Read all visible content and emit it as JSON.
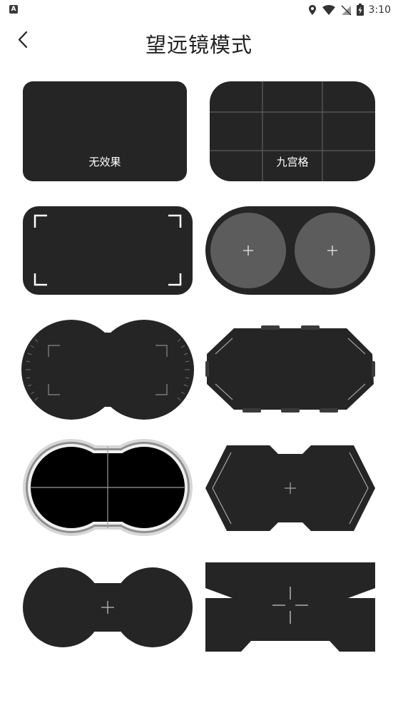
{
  "status_bar": {
    "time": "3:10",
    "left_icon": "A",
    "icons": [
      "location-icon",
      "wifi-icon",
      "no-sim-icon",
      "battery-charging-icon"
    ]
  },
  "header": {
    "title": "望远镜模式",
    "back_icon": "chevron-left-icon"
  },
  "modes": [
    {
      "id": "no-effect",
      "label": "无效果"
    },
    {
      "id": "nine-grid",
      "label": "九宫格"
    },
    {
      "id": "corner-brackets",
      "label": ""
    },
    {
      "id": "twin-circles",
      "label": ""
    },
    {
      "id": "binocular-scale",
      "label": ""
    },
    {
      "id": "octagon",
      "label": ""
    },
    {
      "id": "binocular-metal",
      "label": ""
    },
    {
      "id": "hexagon-notch",
      "label": ""
    },
    {
      "id": "dumbbell",
      "label": ""
    },
    {
      "id": "bowtie-crosshair",
      "label": ""
    }
  ],
  "colors": {
    "tile_dark": "#252525",
    "lens_gray": "#5c5c5c",
    "line_gray": "#6a6a6a",
    "text_white": "#ffffff"
  }
}
